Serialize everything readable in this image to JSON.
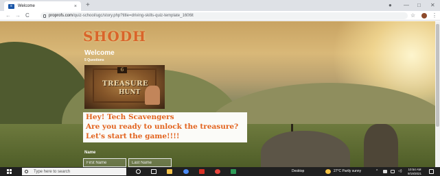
{
  "browser": {
    "tab_title": "Welcome",
    "tab_close": "×",
    "new_tab": "+",
    "url_host": "proprofs.com",
    "url_path": "/quiz-school/ugc/story.php?title=driving-skills-quiz-template_1606lt",
    "back_glyph": "←",
    "forward_glyph": "→",
    "reload_glyph": "C",
    "star_glyph": "☆",
    "menu_glyph": "⋮",
    "minimize": "—",
    "maximize": "□",
    "close": "✕"
  },
  "quiz": {
    "brand": "SHODH",
    "welcome": "Welcome",
    "questions": "5 Questions",
    "image": {
      "badge": "6",
      "line1": "TREASURE",
      "line2": "HUNT"
    },
    "message_lines": [
      "Hey! Tech Scavengers",
      "Are you ready to unlock the treasure?",
      "Let's start the game!!!!"
    ],
    "name_label": "Name",
    "first_name_placeholder": "First Name",
    "last_name_placeholder": "Last Name"
  },
  "taskbar": {
    "search_placeholder": "Type here to search",
    "desktop_label": "Desktop",
    "weather": "27°C  Partly sunny",
    "time": "10:54 AM",
    "date": "9/19/2021"
  },
  "colors": {
    "brand_orange": "#d9642a",
    "message_orange": "#e2631e",
    "taskbar_bg": "#202020"
  }
}
